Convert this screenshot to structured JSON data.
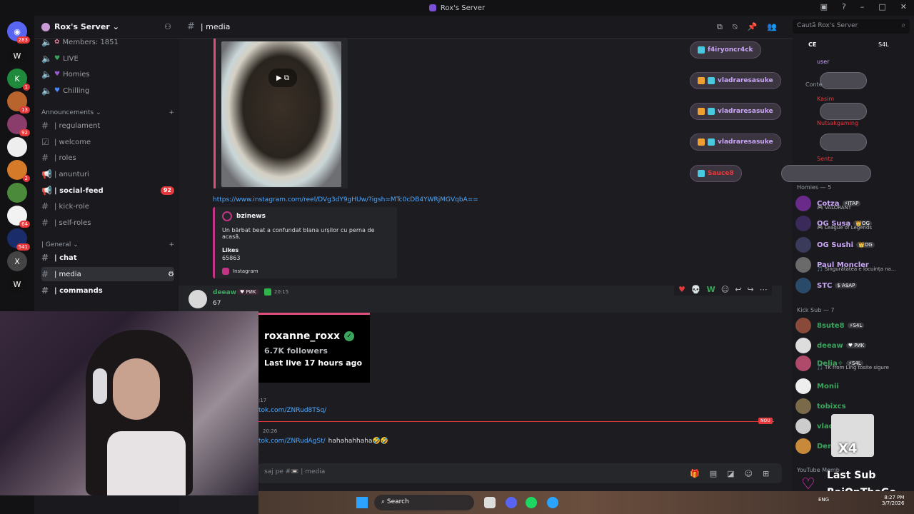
{
  "window": {
    "title": "Rox's Server"
  },
  "rail": {
    "badges": [
      "283",
      "1",
      "13",
      "92",
      "2",
      "64",
      "541"
    ]
  },
  "server": {
    "name": "Rox's Server"
  },
  "sidebar": {
    "top_channels": [
      {
        "emoji": "✿",
        "label": "Members: 1851"
      },
      {
        "emoji": "♥",
        "label": "LIVE"
      },
      {
        "emoji": "♥",
        "label": "Homies"
      },
      {
        "emoji": "♥",
        "label": "Chilling"
      }
    ],
    "cat_announcements": "Announcements",
    "announce_channels": [
      {
        "label": "| regulament"
      },
      {
        "label": "| welcome"
      },
      {
        "label": "| roles"
      },
      {
        "label": "| anunturi"
      },
      {
        "label": "| social-feed",
        "badge": "92"
      },
      {
        "label": "| kick-role"
      },
      {
        "label": "| self-roles"
      }
    ],
    "cat_general": "| General",
    "general_channels": [
      {
        "label": "| chat"
      },
      {
        "label": "| media"
      },
      {
        "label": "| commands"
      }
    ]
  },
  "channel_header": {
    "name": "| media"
  },
  "search": {
    "placeholder": "Caută Rox's Server"
  },
  "embed": {
    "link": "https://www.instagram.com/reel/DVg3dY9gHUw/?igsh=MTc0cDB4YWRjMGVqbA==",
    "author": "bzinews",
    "description": "Un bărbat beat a confundat blana urșilor cu perna de acasă.",
    "likes_label": "Likes",
    "likes_value": "65863",
    "source": "Instagram"
  },
  "message": {
    "author": "deeaw",
    "tag": "♥ PИK",
    "time": "20:15",
    "text": "67"
  },
  "message_actions": [
    "♥",
    "💀",
    "W"
  ],
  "lower_messages": {
    "time1": ":17",
    "link1": "tok.com/ZNRud8TSq/",
    "new_label": "NOU",
    "time2": "20:26",
    "link2": "tok.com/ZNRudAgSt/",
    "text2": "hahahahhaha🤣🤣"
  },
  "composer": {
    "placeholder": "saj pe #📼 | media"
  },
  "kick_overlay": {
    "username": "roxanne_roxx",
    "followers": "6.7K followers",
    "last_live": "Last live 17 hours ago"
  },
  "streams": [
    "f4iryoncr4ck",
    "vladraresasuke",
    "vladraresasuke",
    "vladraresasuke",
    "Sauce8"
  ],
  "members": {
    "partial_top": [
      "CE",
      "S4L",
      "user",
      "Conte",
      "Kasim",
      "Nutsakgaming",
      "Sentz"
    ],
    "homies_header": "Homies — 5",
    "homies": [
      {
        "name": "Cotza",
        "badge": "⚡ITAP",
        "sub": "🎮 VALORANT"
      },
      {
        "name": "OG Susa",
        "badge": "👑OG",
        "sub": "🎮 League of Legends"
      },
      {
        "name": "OG Sushi",
        "badge": "👑OG",
        "sub": ""
      },
      {
        "name": "Paul Moncler",
        "badge": "",
        "sub": "🎵 Singurătatea e locuința na..."
      },
      {
        "name": "STC",
        "badge": "$ A$AP",
        "sub": ""
      }
    ],
    "kick_header": "Kick Sub — 7",
    "kick": [
      {
        "name": "8sute8",
        "badge": "⚡S4L",
        "sub": ""
      },
      {
        "name": "deeaw",
        "badge": "♥ PИK",
        "sub": ""
      },
      {
        "name": "Delia✧",
        "badge": "⚡S4L",
        "sub": "🎵 TK from Ling tosite sigure"
      },
      {
        "name": "Monii",
        "badge": "",
        "sub": ""
      },
      {
        "name": "tobixcs",
        "badge": "",
        "sub": ""
      },
      {
        "name": "vlad",
        "badge": "",
        "sub": ""
      },
      {
        "name": "Deni",
        "badge": "",
        "sub": ""
      }
    ],
    "yt_header": "YouTube Memb"
  },
  "last_sub": {
    "line1": "Last Sub",
    "line2": "RaiOnTheGo",
    "cat_text": "X4"
  },
  "taskbar": {
    "search": "Search",
    "lang": "ENG",
    "time": "8:27 PM",
    "date": "3/7/2026"
  }
}
